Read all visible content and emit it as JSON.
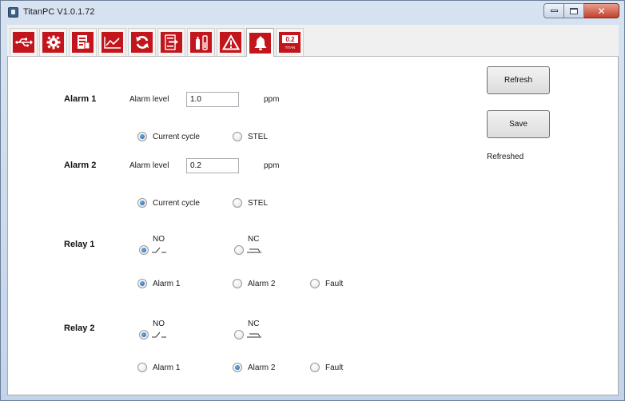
{
  "window": {
    "title": "TitanPC V1.0.1.72"
  },
  "toolbar": {
    "tabs": [
      {
        "icon": "usb-icon"
      },
      {
        "icon": "gear-icon"
      },
      {
        "icon": "document-icon"
      },
      {
        "icon": "line-graph-icon"
      },
      {
        "icon": "refresh-icon"
      },
      {
        "icon": "export-list-icon"
      },
      {
        "icon": "calibration-cylinder-icon"
      },
      {
        "icon": "warning-triangle-icon"
      },
      {
        "icon": "bell-icon",
        "selected": true
      },
      {
        "icon": "titan-display-icon",
        "display_value": "0.2",
        "display_caption": "TITAN"
      }
    ]
  },
  "alarm1": {
    "title": "Alarm 1",
    "level_label": "Alarm level",
    "level_value": "1.0",
    "unit": "ppm",
    "options": [
      "Current cycle",
      "STEL"
    ],
    "selected": "Current cycle"
  },
  "alarm2": {
    "title": "Alarm 2",
    "level_label": "Alarm level",
    "level_value": "0.2",
    "unit": "ppm",
    "options": [
      "Current cycle",
      "STEL"
    ],
    "selected": "Current cycle"
  },
  "relay1": {
    "title": "Relay 1",
    "contact_options": [
      "NO",
      "NC"
    ],
    "contact_selected": "NO",
    "trigger_options": [
      "Alarm 1",
      "Alarm 2",
      "Fault"
    ],
    "trigger_selected": "Alarm 1"
  },
  "relay2": {
    "title": "Relay 2",
    "contact_options": [
      "NO",
      "NC"
    ],
    "contact_selected": "NO",
    "trigger_options": [
      "Alarm 1",
      "Alarm 2",
      "Fault"
    ],
    "trigger_selected": "Alarm 2"
  },
  "actions": {
    "refresh_label": "Refresh",
    "save_label": "Save"
  },
  "status": {
    "text": "Refreshed"
  },
  "colors": {
    "tab_red": "#c3161c",
    "radio_selected": "#1e5d9e"
  }
}
